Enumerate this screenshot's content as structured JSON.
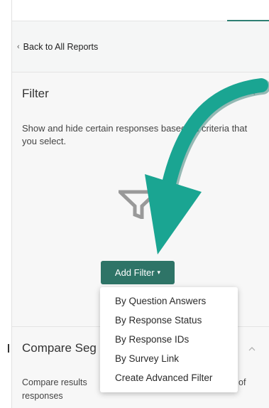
{
  "back_link": {
    "label": "Back to All Reports"
  },
  "filter": {
    "title": "Filter",
    "description": "Show and hide certain responses based on criteria that you select.",
    "add_button": "Add Filter",
    "menu": [
      "By Question Answers",
      "By Response Status",
      "By Response IDs",
      "By Survey Link",
      "Create Advanced Filter"
    ]
  },
  "compare": {
    "title": "Compare Seg",
    "desc_part1": "Compare results",
    "desc_part2": "of",
    "desc_part3": "responses"
  },
  "colors": {
    "accent": "#2e7467",
    "arrow": "#1aa592"
  },
  "icons": {
    "back": "chevron-left-icon",
    "collapse": "chevron-up-icon",
    "funnel": "funnel-icon",
    "caret": "caret-down-icon"
  }
}
